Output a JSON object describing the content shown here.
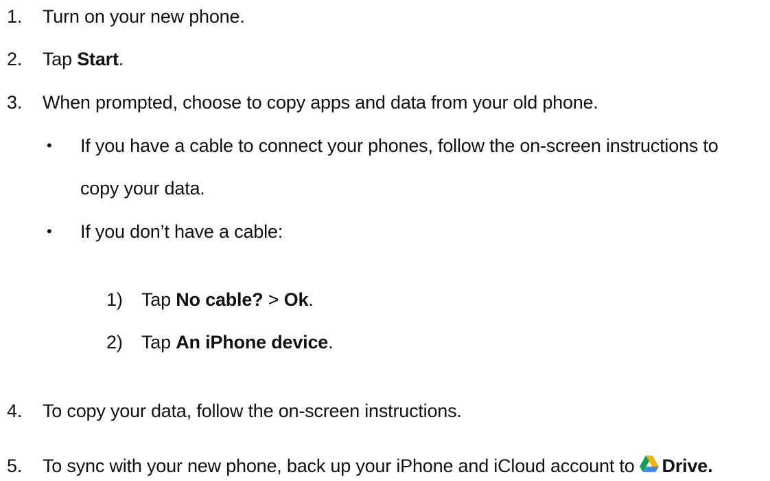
{
  "steps": [
    {
      "num": "1.",
      "text": "Turn on your new phone."
    },
    {
      "num": "2.",
      "prefix": "Tap ",
      "bold": "Start",
      "suffix": "."
    },
    {
      "num": "3.",
      "text": "When prompted, choose to copy apps and data from your old phone."
    },
    {
      "num": "4.",
      "text": "To copy your data, follow the on-screen instructions."
    },
    {
      "num": "5.",
      "prefix": "To sync with your new phone, back up your iPhone and iCloud account to",
      "bold": "Drive."
    }
  ],
  "bullets": [
    {
      "bullet": "•",
      "line1": "If you have a cable to connect your phones, follow the on-screen instructions to",
      "line2": "copy your data."
    },
    {
      "bullet": "•",
      "text": "If you don’t have a cable:"
    }
  ],
  "substeps": [
    {
      "num": "1)",
      "prefix": "Tap ",
      "bold1": "No cable?",
      "middle": " > ",
      "bold2": "Ok",
      "suffix": "."
    },
    {
      "num": "2)",
      "prefix": "Tap ",
      "bold": "An iPhone device",
      "suffix": "."
    }
  ],
  "icons": {
    "drive": "google-drive-icon"
  },
  "colors": {
    "text": "#111111",
    "drive_green": "#0F9D58",
    "drive_yellow": "#F4B400",
    "drive_blue": "#4285F4"
  }
}
